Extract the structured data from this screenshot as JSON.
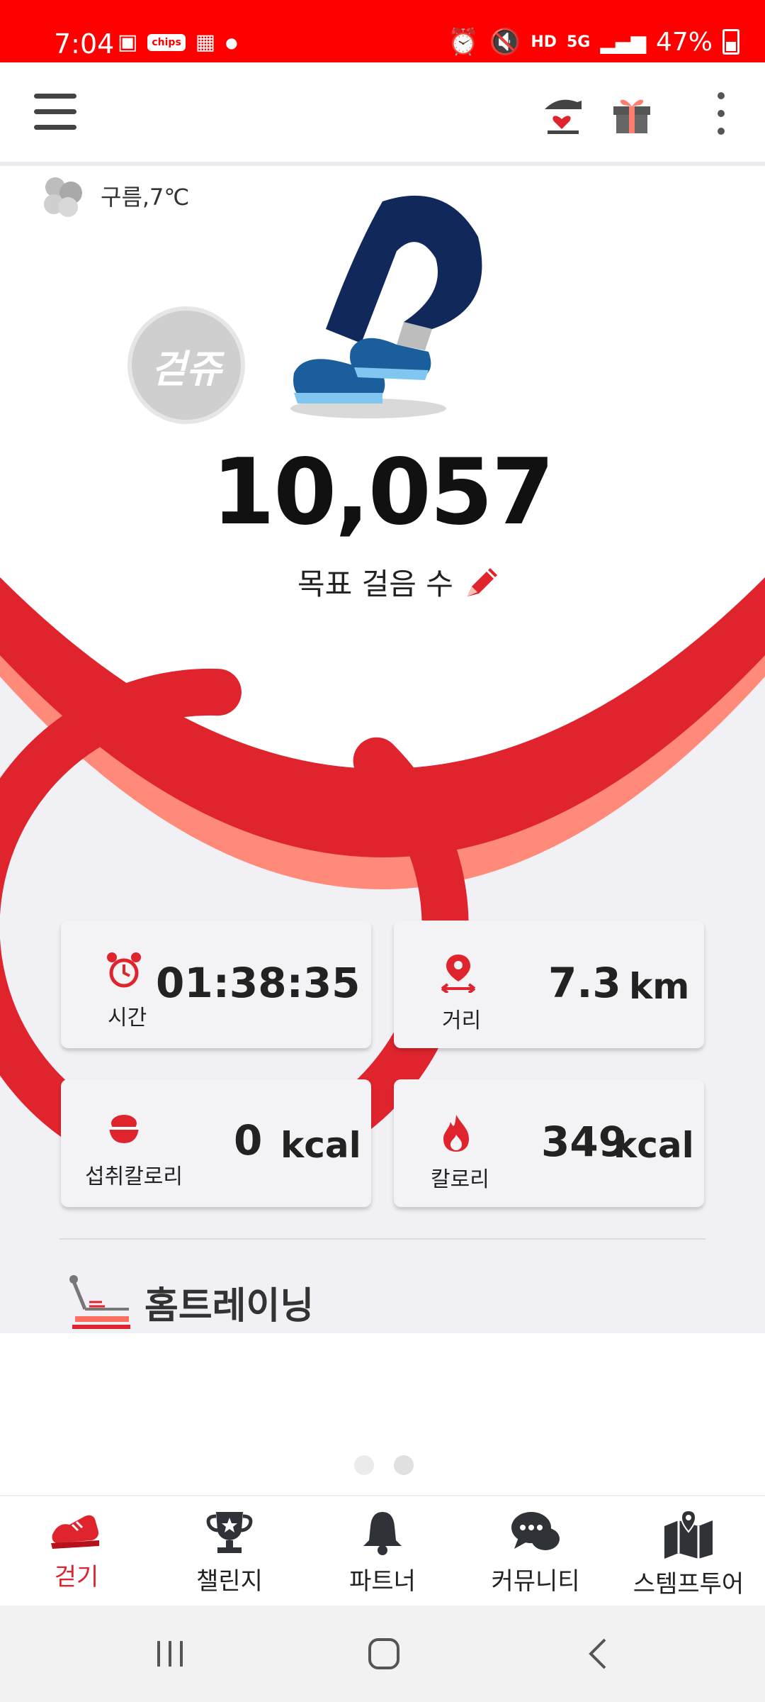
{
  "status_bar": {
    "time": "7:04",
    "chip_label": "chips",
    "battery": "47%",
    "hd_label": "HD",
    "network_label": "5G"
  },
  "weather": {
    "label": "구름,7℃"
  },
  "badge": {
    "label": "걷쥬"
  },
  "hero": {
    "step_count": "10,057",
    "goal_label": "목표 걸음 수",
    "progress_fraction": 0.88
  },
  "stats": {
    "time": {
      "label": "시간",
      "value": "01:38:35"
    },
    "distance": {
      "label": "거리",
      "value": "7.3",
      "unit": "km"
    },
    "intake": {
      "label": "섭취칼로리",
      "value": "0",
      "unit": "kcal"
    },
    "calories": {
      "label": "칼로리",
      "value": "349",
      "unit": "kcal"
    }
  },
  "section": {
    "home_training": "홈트레이닝"
  },
  "bottom_nav": [
    {
      "label": "걷기",
      "icon": "shoe-icon",
      "active": true
    },
    {
      "label": "챌린지",
      "icon": "trophy-icon",
      "active": false
    },
    {
      "label": "파트너",
      "icon": "bell-icon",
      "active": false
    },
    {
      "label": "커뮤니티",
      "icon": "chat-icon",
      "active": false
    },
    {
      "label": "스템프투어",
      "icon": "map-icon",
      "active": false
    }
  ],
  "colors": {
    "accent": "#e0242e",
    "accent_light": "#ff8a7a",
    "status_bar": "#ff0000",
    "background": "#f1f1f5"
  }
}
